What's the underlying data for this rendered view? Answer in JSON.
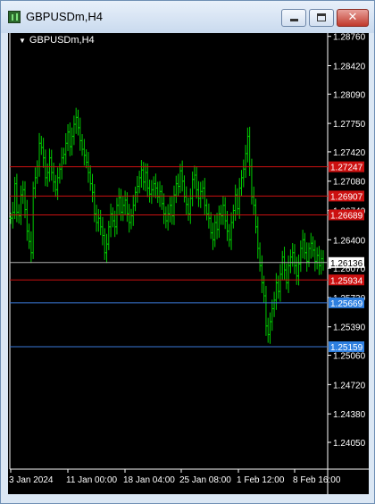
{
  "window": {
    "title": "GBPUSDm,H4",
    "close_label": "✕"
  },
  "chart_header": {
    "symbol_label": "GBPUSDm,H4",
    "menu_arrow": "▼"
  },
  "chart_data": {
    "type": "bar",
    "chart_style": "ohlc-bars",
    "bar_color": "#00cc00",
    "background": "#000000",
    "y_axis": {
      "range": [
        1.2405,
        1.2885
      ],
      "ticks": [
        "1.28760",
        "1.28420",
        "1.28090",
        "1.27750",
        "1.27420",
        "1.27080",
        "1.26740",
        "1.26400",
        "1.26070",
        "1.25730",
        "1.25390",
        "1.25060",
        "1.24720",
        "1.24380",
        "1.24050"
      ]
    },
    "x_axis": {
      "ticks": [
        "3 Jan 2024",
        "11 Jan 00:00",
        "18 Jan 04:00",
        "25 Jan 08:00",
        "1 Feb 12:00",
        "8 Feb 16:00"
      ]
    },
    "price_lines": [
      {
        "price": 1.27247,
        "label": "1.27247",
        "color": "#cc1010",
        "label_bg": "#cc1010"
      },
      {
        "price": 1.26907,
        "label": "1.26907",
        "color": "#cc1010",
        "label_bg": "#cc1010"
      },
      {
        "price": 1.26689,
        "label": "1.26689",
        "color": "#cc1010",
        "label_bg": "#cc1010"
      },
      {
        "price": 1.26136,
        "label": "1.26136",
        "color": "#b0b0b0",
        "label_bg": "#ffffff"
      },
      {
        "price": 1.25934,
        "label": "1.25934",
        "color": "#cc1010",
        "label_bg": "#cc1010"
      },
      {
        "price": 1.25669,
        "label": "1.25669",
        "color": "#3a78d8",
        "label_bg": "#2d7fe0"
      },
      {
        "price": 1.25159,
        "label": "1.25159",
        "color": "#3a78d8",
        "label_bg": "#2d7fe0"
      }
    ],
    "series": [
      {
        "prices": [
          1.2665,
          1.2672,
          1.2705,
          1.2672,
          1.2668,
          1.2692,
          1.2698,
          1.2675,
          1.265,
          1.2638,
          1.2625,
          1.27,
          1.2712,
          1.2725,
          1.2752,
          1.2747,
          1.2735,
          1.2712,
          1.2718,
          1.2735,
          1.2718,
          1.2707,
          1.2698,
          1.2712,
          1.2722,
          1.2735,
          1.2739,
          1.2752,
          1.2765,
          1.2748,
          1.276,
          1.2774,
          1.2782,
          1.277,
          1.2755,
          1.2745,
          1.2738,
          1.273,
          1.2718,
          1.2705,
          1.2695,
          1.267,
          1.266,
          1.2665,
          1.2655,
          1.2645,
          1.2625,
          1.2635,
          1.2655,
          1.267,
          1.2662,
          1.2655,
          1.268,
          1.2689,
          1.2672,
          1.268,
          1.2686,
          1.267,
          1.266,
          1.2668,
          1.268,
          1.2695,
          1.2702,
          1.2712,
          1.2721,
          1.2707,
          1.2718,
          1.27,
          1.2693,
          1.2698,
          1.2705,
          1.27,
          1.269,
          1.2696,
          1.2682,
          1.267,
          1.2662,
          1.267,
          1.268,
          1.2668,
          1.2692,
          1.2705,
          1.2702,
          1.272,
          1.2708,
          1.269,
          1.2681,
          1.267,
          1.2688,
          1.271,
          1.2715,
          1.2698,
          1.2688,
          1.2696,
          1.27,
          1.268,
          1.267,
          1.2665,
          1.2648,
          1.264,
          1.266,
          1.2652,
          1.267,
          1.2668,
          1.268,
          1.2662,
          1.265,
          1.264,
          1.266,
          1.2674,
          1.2692,
          1.2676,
          1.27,
          1.2712,
          1.2722,
          1.274,
          1.276,
          1.2725,
          1.269,
          1.268,
          1.2655,
          1.263,
          1.261,
          1.259,
          1.2575,
          1.254,
          1.253,
          1.2545,
          1.256,
          1.257,
          1.259,
          1.258,
          1.26,
          1.262,
          1.2605,
          1.259,
          1.261,
          1.262,
          1.2625,
          1.261,
          1.2598,
          1.2612,
          1.263,
          1.264,
          1.2625,
          1.2615,
          1.263,
          1.2636,
          1.2628,
          1.2615,
          1.2622,
          1.261,
          1.2618,
          1.2614
        ]
      }
    ]
  }
}
